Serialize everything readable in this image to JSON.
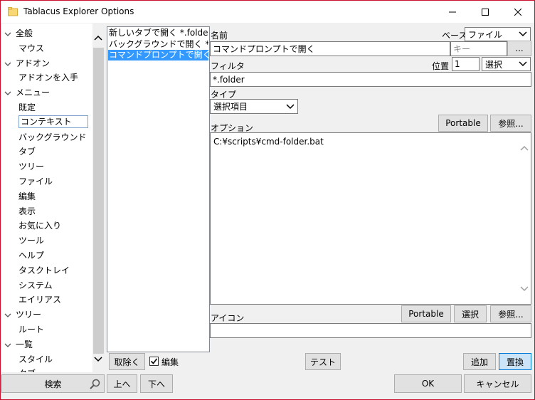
{
  "window": {
    "title": "Tablacus Explorer Options",
    "minimize": "—",
    "maximize": "☐",
    "close": "✕"
  },
  "tree": [
    {
      "label": "全般",
      "level": 0,
      "expanded": true
    },
    {
      "label": "マウス",
      "level": 1
    },
    {
      "label": "アドオン",
      "level": 0,
      "expanded": true
    },
    {
      "label": "アドオンを入手",
      "level": 1
    },
    {
      "label": "メニュー",
      "level": 0,
      "expanded": true
    },
    {
      "label": "既定",
      "level": 1
    },
    {
      "label": "コンテキスト",
      "level": 1,
      "selected": true
    },
    {
      "label": "バックグラウンド",
      "level": 1
    },
    {
      "label": "タブ",
      "level": 1
    },
    {
      "label": "ツリー",
      "level": 1
    },
    {
      "label": "ファイル",
      "level": 1
    },
    {
      "label": "編集",
      "level": 1
    },
    {
      "label": "表示",
      "level": 1
    },
    {
      "label": "お気に入り",
      "level": 1
    },
    {
      "label": "ツール",
      "level": 1
    },
    {
      "label": "ヘルプ",
      "level": 1
    },
    {
      "label": "タスクトレイ",
      "level": 1
    },
    {
      "label": "システム",
      "level": 1
    },
    {
      "label": "エイリアス",
      "level": 1
    },
    {
      "label": "ツリー",
      "level": 0,
      "expanded": true
    },
    {
      "label": "ルート",
      "level": 1
    },
    {
      "label": "一覧",
      "level": 0,
      "expanded": true
    },
    {
      "label": "スタイル",
      "level": 1
    },
    {
      "label": "タブ",
      "level": 1
    }
  ],
  "search_button": "検索",
  "menu_list": [
    {
      "label": "新しいタブで開く *.folder"
    },
    {
      "label": "バックグラウンドで開く *.folder"
    },
    {
      "label": "コマンドプロンプトで開く *.folder",
      "selected": true
    }
  ],
  "form": {
    "name_label": "名前",
    "name_value": "コマンドプロンプトで開く",
    "key_placeholder": "キー",
    "browse_button": "...",
    "base_label": "ベース",
    "base_value": "ファイル",
    "filter_label": "フィルタ",
    "filter_value": "*.folder",
    "position_label": "位置",
    "position_value": "1",
    "position_select": "選択",
    "type_label": "タイプ",
    "type_value": "選択項目",
    "option_label": "オプション",
    "portable_button": "Portable",
    "browse_ref_button": "参照...",
    "option_value": "C:¥scripts¥cmd-folder.bat",
    "icon_label": "アイコン",
    "icon_portable_button": "Portable",
    "icon_select_button": "選択",
    "icon_browse_button": "参照..."
  },
  "bottom": {
    "remove_button": "取除く",
    "edit_checkbox_label": "編集",
    "edit_checked": true,
    "test_button": "テスト",
    "add_button": "追加",
    "replace_button": "置換",
    "up_button": "上へ",
    "down_button": "下へ",
    "ok_button": "OK",
    "cancel_button": "キャンセル"
  }
}
